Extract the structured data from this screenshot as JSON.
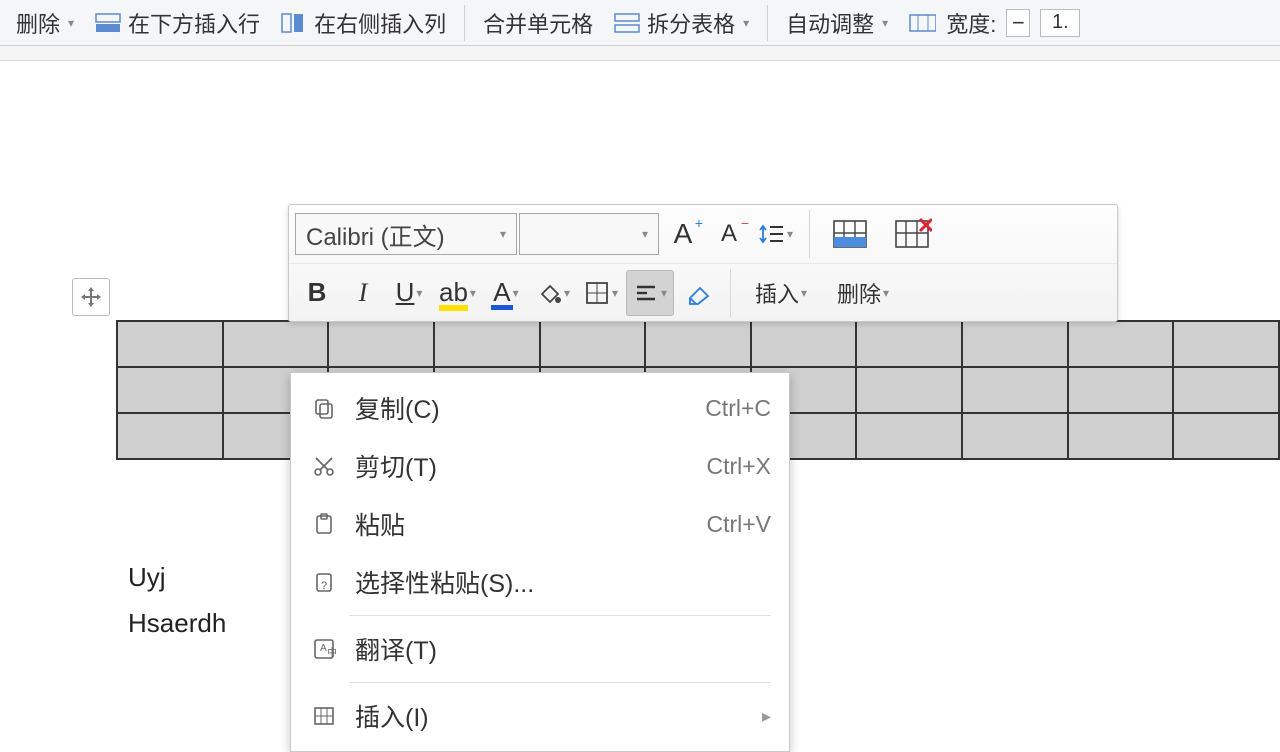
{
  "ribbon": {
    "delete": "删除",
    "insert_row_below": "在下方插入行",
    "insert_col_right": "在右侧插入列",
    "merge_cells": "合并单元格",
    "split_table": "拆分表格",
    "auto_fit": "自动调整",
    "width_label": "宽度:",
    "width_value": "1."
  },
  "mini": {
    "font_name": "Calibri (正文)",
    "bold": "B",
    "italic": "I",
    "underline": "U",
    "insert": "插入",
    "delete": "删除"
  },
  "ctx": {
    "copy": {
      "label": "复制(C)",
      "shortcut": "Ctrl+C"
    },
    "cut": {
      "label": "剪切(T)",
      "shortcut": "Ctrl+X"
    },
    "paste": {
      "label": "粘贴",
      "shortcut": "Ctrl+V"
    },
    "paste_special": {
      "label": "选择性粘贴(S)..."
    },
    "translate": {
      "label": "翻译(T)"
    },
    "insert": {
      "label": "插入(I)"
    }
  },
  "body_text": {
    "line1": "Uyj",
    "line2": "Hsaerdh"
  }
}
